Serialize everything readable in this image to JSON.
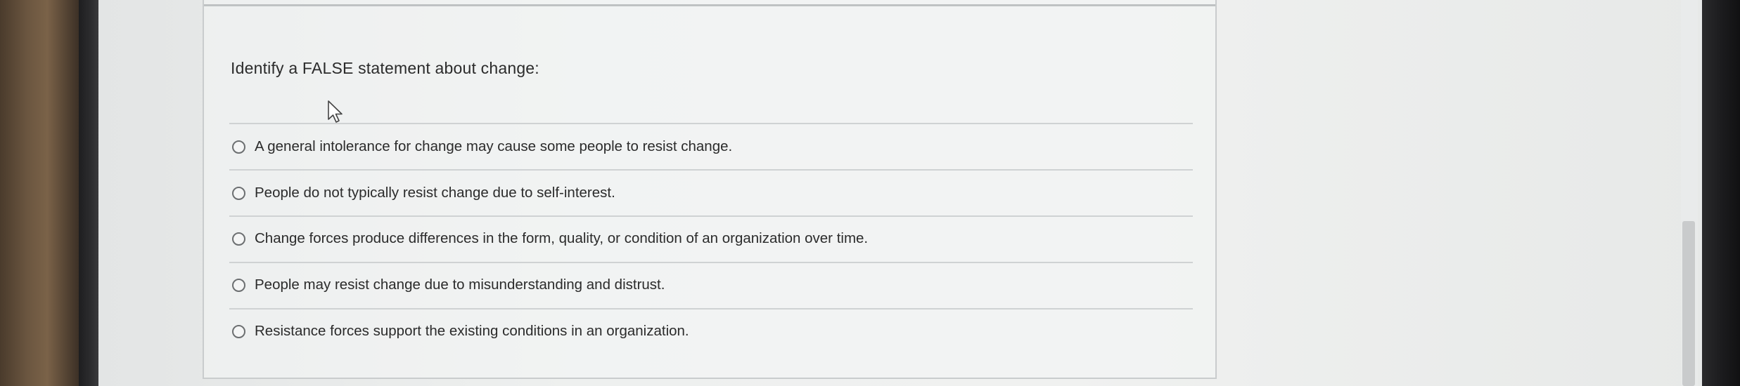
{
  "question": {
    "prompt": "Identify a FALSE statement about change:",
    "options": [
      {
        "label": "A general intolerance for change may cause some people to resist change.",
        "selected": false
      },
      {
        "label": "People do not typically resist change due to self-interest.",
        "selected": false
      },
      {
        "label": "Change forces produce differences in the form, quality, or condition of an organization over time.",
        "selected": false
      },
      {
        "label": "People may resist change due to misunderstanding and distrust.",
        "selected": false
      },
      {
        "label": "Resistance forces support the existing conditions in an organization.",
        "selected": false
      }
    ]
  },
  "icons": {
    "cursor": "mouse-pointer-icon",
    "radio": "radio-unselected-icon"
  },
  "colors": {
    "text": "#2b2b2b",
    "divider": "#cfd2d3",
    "radio_border": "#6c6f71"
  }
}
